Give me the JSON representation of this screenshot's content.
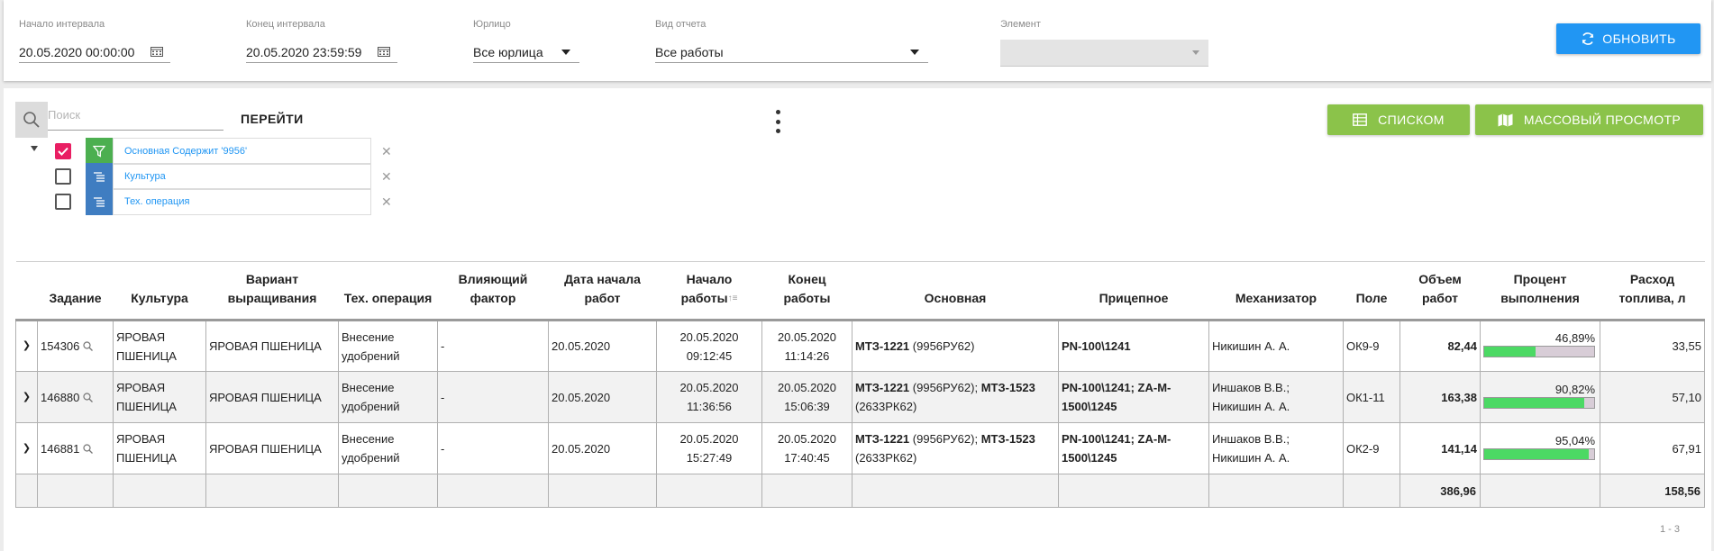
{
  "filters": {
    "interval_start": {
      "label": "Начало интервала",
      "value": "20.05.2020 00:00:00"
    },
    "interval_end": {
      "label": "Конец интервала",
      "value": "20.05.2020 23:59:59"
    },
    "legal_entity": {
      "label": "Юрлицо",
      "value": "Все юрлица"
    },
    "report_type": {
      "label": "Вид отчета",
      "value": "Все работы"
    },
    "element": {
      "label": "Элемент",
      "value": ""
    },
    "refresh_label": "ОБНОВИТЬ"
  },
  "toolbar": {
    "search_placeholder": "Поиск",
    "goto_label": "ПЕРЕЙТИ",
    "list_label": "СПИСКОМ",
    "mass_view_label": "МАССОВЫЙ ПРОСМОТР"
  },
  "filter_tree": [
    {
      "label": "Основная Содержит '9956'",
      "checked": true,
      "icon": "funnel-icon"
    },
    {
      "label": "Культура",
      "checked": false,
      "icon": "group-list-icon"
    },
    {
      "label": "Тех. операция",
      "checked": false,
      "icon": "group-list-icon"
    }
  ],
  "table": {
    "headers": {
      "task": "Задание",
      "culture": "Культура",
      "variant": "Вариант выращивания",
      "operation": "Тех. операция",
      "factor": "Влияющий фактор",
      "date_start": "Дата начала работ",
      "work_start": "Начало работы",
      "work_end": "Конец работы",
      "main": "Основная",
      "trailer": "Прицепное",
      "operator": "Механизатор",
      "field": "Поле",
      "volume": "Объем работ",
      "percent": "Процент выполнения",
      "fuel": "Расход топлива, л"
    },
    "rows": [
      {
        "task": "154306",
        "culture": "ЯРОВАЯ ПШЕНИЦА",
        "variant": "ЯРОВАЯ ПШЕНИЦА",
        "operation": "Внесение удобрений",
        "factor": "-",
        "date_start": "20.05.2020",
        "work_start": "20.05.2020 09:12:45",
        "work_end": "20.05.2020 11:14:26",
        "main_1_bold": "МТЗ-1221",
        "main_1_rest": " (9956РУ62)",
        "main_2_bold": "",
        "main_2_rest": "",
        "trailer": "PN-100\\1241",
        "operator": "Никишин А. А.",
        "field": "ОК9-9",
        "volume": "82,44",
        "percent_text": "46,89%",
        "percent": 46.89,
        "fuel": "33,55"
      },
      {
        "task": "146880",
        "culture": "ЯРОВАЯ ПШЕНИЦА",
        "variant": "ЯРОВАЯ ПШЕНИЦА",
        "operation": "Внесение удобрений",
        "factor": "-",
        "date_start": "20.05.2020",
        "work_start": "20.05.2020 11:36:56",
        "work_end": "20.05.2020 15:06:39",
        "main_1_bold": "МТЗ-1221",
        "main_1_rest": " (9956РУ62); ",
        "main_2_bold": "МТЗ-1523",
        "main_2_rest": " (2633РК62)",
        "trailer": "PN-100\\1241; ZA-M-1500\\1245",
        "operator": "Иншаков В.В.; Никишин А. А.",
        "field": "ОК1-11",
        "volume": "163,38",
        "percent_text": "90,82%",
        "percent": 90.82,
        "fuel": "57,10"
      },
      {
        "task": "146881",
        "culture": "ЯРОВАЯ ПШЕНИЦА",
        "variant": "ЯРОВАЯ ПШЕНИЦА",
        "operation": "Внесение удобрений",
        "factor": "-",
        "date_start": "20.05.2020",
        "work_start": "20.05.2020 15:27:49",
        "work_end": "20.05.2020 17:40:45",
        "main_1_bold": "МТЗ-1221",
        "main_1_rest": " (9956РУ62); ",
        "main_2_bold": "МТЗ-1523",
        "main_2_rest": " (2633РК62)",
        "trailer": "PN-100\\1241; ZA-M-1500\\1245",
        "operator": "Иншаков В.В.; Никишин А. А.",
        "field": "ОК2-9",
        "volume": "141,14",
        "percent_text": "95,04%",
        "percent": 95.04,
        "fuel": "67,91"
      }
    ],
    "totals": {
      "volume": "386,96",
      "fuel": "158,56"
    }
  },
  "pager": "1 - 3",
  "colors": {
    "refresh": "#2196f3",
    "green_buttons": "#8bc34a",
    "checkbox_on": "#e91e63",
    "progress_fill": "#4cd964",
    "link_text": "#2196f3"
  }
}
